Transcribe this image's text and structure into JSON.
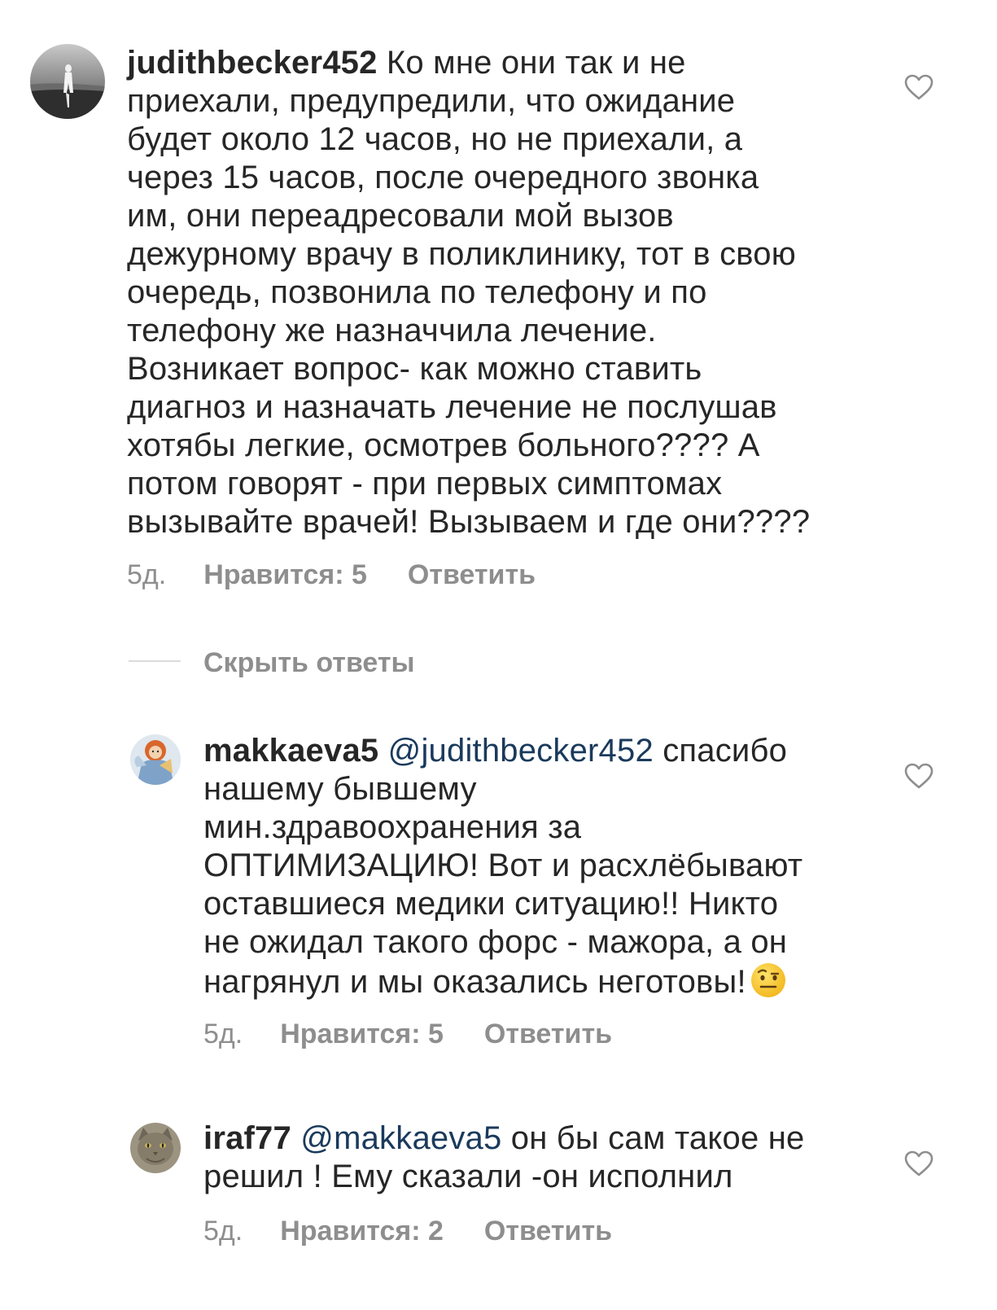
{
  "comments": [
    {
      "username": "judithbecker452",
      "mention": "",
      "text": " Ко мне они так и не\nприехали, предупредили, что ожидание\nбудет около 12 часов, но не приехали, а\nчерез 15 часов, после очередного звонка\nим, они переадресовали мой вызов\nдежурному врачу в поликлинику, тот в свою\nочередь, позвонила по телефону и по\nтелефону же назначчила лечение.\nВозникает вопрос- как можно ставить\nдиагноз и назначать лечение не послушав\nхотябы легкие, осмотрев больного???? А\nпотом говорят - при первых симптомах\nвызывайте врачей! Вызываем и где они????",
      "time": "5д.",
      "likes": "Нравится: 5",
      "reply": "Ответить",
      "avatar_icon": "woman-on-beach-avatar"
    },
    {
      "username": "makkaeva5",
      "mention": " @judithbecker452",
      "text": " спасибо\nнашему бывшему\nмин.здравоохранения за\nОПТИМИЗАЦИЮ! Вот и расхлёбывают\nоставшиеся медики ситуацию!! Никто\nне ожидал такого форс - мажора, а он\nнагрянул и мы оказались неготовы!",
      "emoji": "raised-eyebrow-emoji",
      "time": "5д.",
      "likes": "Нравится: 5",
      "reply": "Ответить",
      "avatar_icon": "angel-illustration-avatar"
    },
    {
      "username": "iraf77",
      "mention": " @makkaeva5",
      "text": " он бы сам такое не\nрешил ! Ему сказали -он исполнил",
      "time": "5д.",
      "likes": "Нравится: 2",
      "reply": "Ответить",
      "avatar_icon": "cat-avatar"
    }
  ],
  "hide_replies": "Скрыть ответы",
  "colors": {
    "text": "#262626",
    "secondary": "#8e8e8e",
    "mention": "#1a3a5c",
    "divider": "#dbdbdb"
  }
}
